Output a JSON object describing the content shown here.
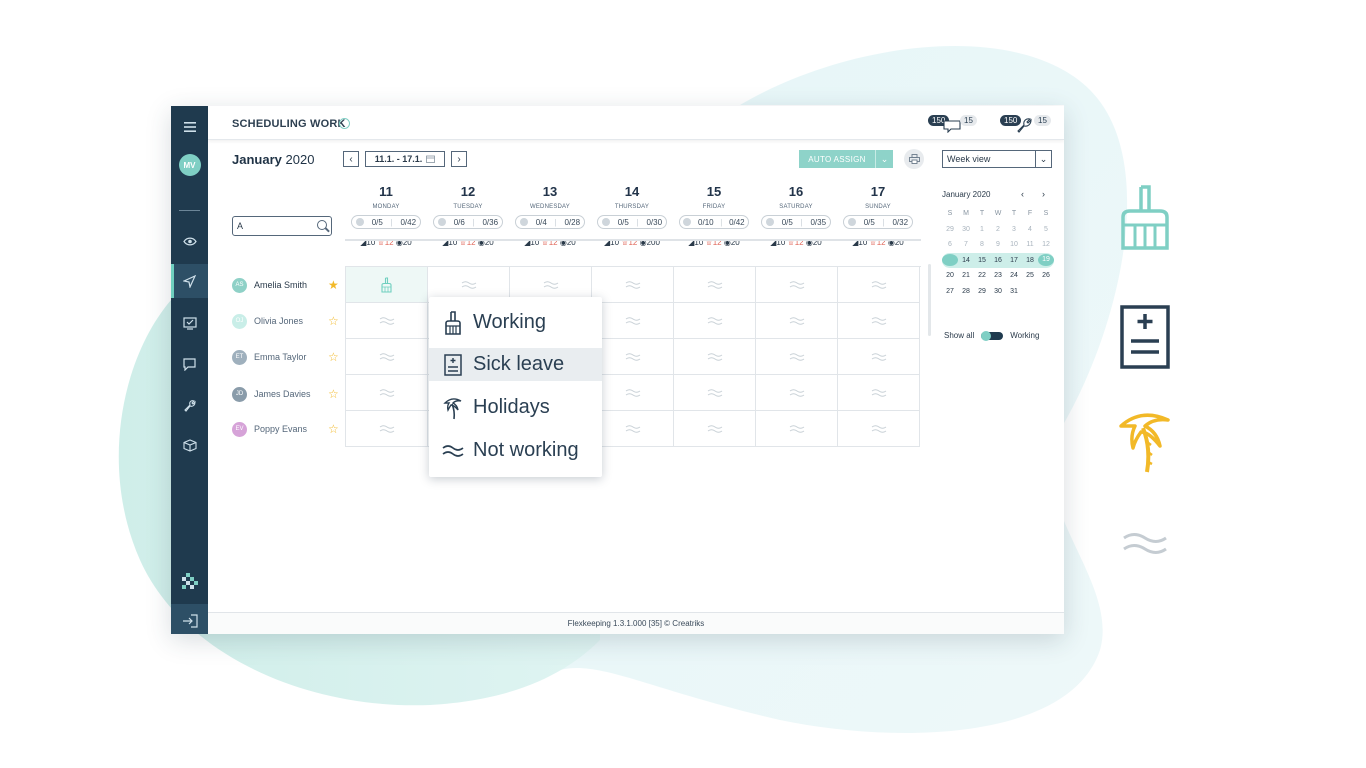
{
  "header": {
    "title": "SCHEDULING WORK",
    "notifications": [
      {
        "name": "messages",
        "primary": "150",
        "secondary": "15"
      },
      {
        "name": "maintenance",
        "primary": "150",
        "secondary": "15"
      }
    ]
  },
  "user": {
    "initials": "MV"
  },
  "toolbar": {
    "month_bold": "January",
    "year": "2020",
    "range": "11.1. - 17.1.",
    "auto_assign": "AUTO ASSIGN",
    "view_select": "Week view"
  },
  "search": {
    "value": "A"
  },
  "days": [
    {
      "num": "11",
      "name": "MONDAY",
      "a": "0/5",
      "b": "0/42",
      "s1": "10",
      "s2": "12",
      "s3": "20"
    },
    {
      "num": "12",
      "name": "TUESDAY",
      "a": "0/6",
      "b": "0/36",
      "s1": "10",
      "s2": "12",
      "s3": "20"
    },
    {
      "num": "13",
      "name": "WEDNESDAY",
      "a": "0/4",
      "b": "0/28",
      "s1": "10",
      "s2": "12",
      "s3": "20"
    },
    {
      "num": "14",
      "name": "THURSDAY",
      "a": "0/5",
      "b": "0/30",
      "s1": "10",
      "s2": "12",
      "s3": "200"
    },
    {
      "num": "15",
      "name": "FRIDAY",
      "a": "0/10",
      "b": "0/42",
      "s1": "10",
      "s2": "12",
      "s3": "20"
    },
    {
      "num": "16",
      "name": "SATURDAY",
      "a": "0/5",
      "b": "0/35",
      "s1": "10",
      "s2": "12",
      "s3": "20"
    },
    {
      "num": "17",
      "name": "SUNDAY",
      "a": "0/5",
      "b": "0/32",
      "s1": "10",
      "s2": "12",
      "s3": "20"
    }
  ],
  "employees": [
    {
      "initials": "AS",
      "name": "Amelia Smith",
      "color": "#8fd1c7",
      "starred": true
    },
    {
      "initials": "OJ",
      "name": "Olivia Jones",
      "color": "#c9eee8",
      "starred": false
    },
    {
      "initials": "ET",
      "name": "Emma Taylor",
      "color": "#9fb0bd",
      "starred": false
    },
    {
      "initials": "JD",
      "name": "James Davies",
      "color": "#8a9caa",
      "starred": false
    },
    {
      "initials": "EV",
      "name": "Poppy Evans",
      "color": "#d6a3d8",
      "starred": false
    }
  ],
  "mini_calendar": {
    "title": "January 2020",
    "weekdays": [
      "S",
      "M",
      "T",
      "W",
      "T",
      "F",
      "S"
    ],
    "weeks": [
      {
        "days": [
          "29",
          "30",
          "1",
          "2",
          "3",
          "4",
          "5"
        ],
        "dim": true
      },
      {
        "days": [
          "6",
          "7",
          "8",
          "9",
          "10",
          "11",
          "12"
        ],
        "dim": true
      },
      {
        "days": [
          "",
          "14",
          "15",
          "16",
          "17",
          "18",
          "19"
        ],
        "selected": true
      },
      {
        "days": [
          "20",
          "21",
          "22",
          "23",
          "24",
          "25",
          "26"
        ]
      },
      {
        "days": [
          "27",
          "28",
          "29",
          "30",
          "31",
          "",
          ""
        ]
      }
    ]
  },
  "toggle": {
    "left": "Show all",
    "right": "Working"
  },
  "footer": {
    "text": "Flexkeeping 1.3.1.000 [35] © Creatriks"
  },
  "popup": {
    "items": [
      {
        "icon": "broom-icon",
        "label": "Working"
      },
      {
        "icon": "medical-document-icon",
        "label": "Sick leave"
      },
      {
        "icon": "palm-tree-icon",
        "label": "Holidays"
      },
      {
        "icon": "wave-icon",
        "label": "Not working"
      }
    ]
  },
  "colors": {
    "teal": "#7fcfc4",
    "navy": "#1f3a4e",
    "orange": "#f2b928",
    "red": "#e0675a"
  }
}
